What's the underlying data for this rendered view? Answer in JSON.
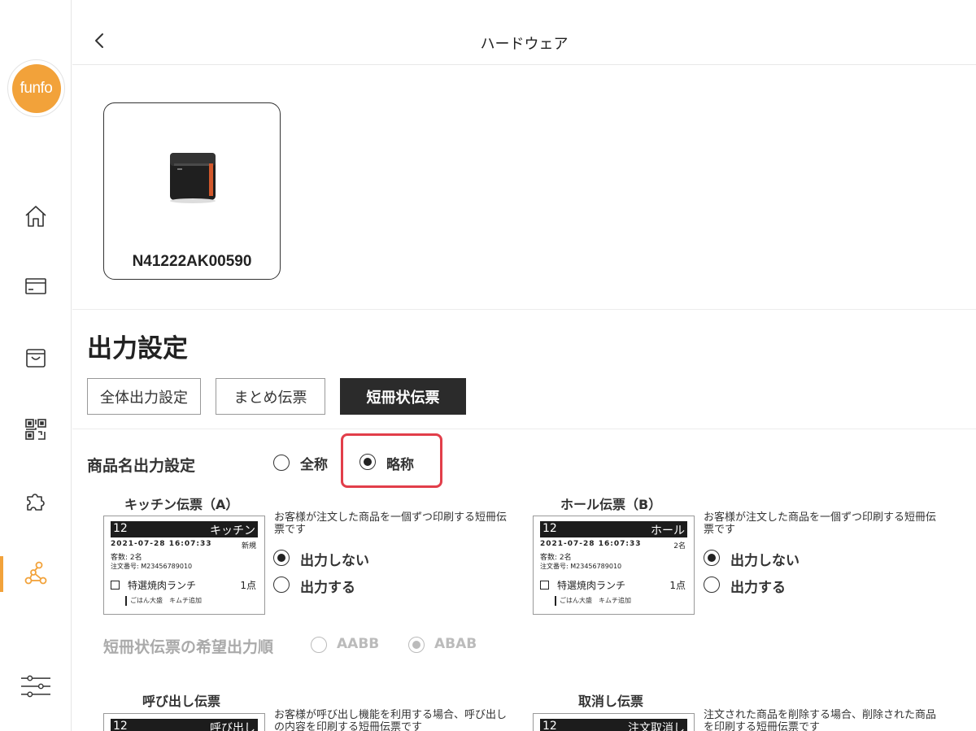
{
  "sidebar": {
    "logo_text": "funfo",
    "accent_color": "#f2a23a",
    "nav_items": [
      {
        "icon": "home-icon"
      },
      {
        "icon": "card-icon"
      },
      {
        "icon": "bag-icon"
      },
      {
        "icon": "qr-code-icon"
      },
      {
        "icon": "puzzle-icon"
      },
      {
        "icon": "network-icon",
        "active": true
      },
      {
        "icon": "settings-sliders-icon"
      }
    ]
  },
  "header": {
    "title": "ハードウェア",
    "back_icon": "chevron-left-icon"
  },
  "device": {
    "id": "N41222AK00590",
    "icon": "printer-icon"
  },
  "output_settings": {
    "title": "出力設定",
    "tabs": [
      {
        "label": "全体出力設定",
        "active": false
      },
      {
        "label": "まとめ伝票",
        "active": false
      },
      {
        "label": "短冊状伝票",
        "active": true
      }
    ],
    "product_name": {
      "label": "商品名出力設定",
      "options": [
        "全称",
        "略称"
      ],
      "selected": "略称"
    },
    "kitchen": {
      "title": "キッチン伝票（A）",
      "description": "お客様が注文した商品を一個ずつ印刷する短冊伝票です",
      "options": [
        "出力しない",
        "出力する"
      ],
      "selected": "出力しない",
      "ticket": {
        "number": "12",
        "destination": "キッチン",
        "datetime": "2021-07-28 16:07:33",
        "status": "新規",
        "guests": "客数: 2名",
        "order_no": "注文番号: M23456789010",
        "item": "特選焼肉ランチ",
        "qty": "1点",
        "options": "ごはん大盛　キムチ追加"
      }
    },
    "hall": {
      "title": "ホール伝票（B）",
      "description": "お客様が注文した商品を一個ずつ印刷する短冊伝票です",
      "options": [
        "出力しない",
        "出力する"
      ],
      "selected": "出力しない",
      "ticket": {
        "number": "12",
        "destination": "ホール",
        "datetime": "2021-07-28 16:07:33",
        "status": "2名",
        "guests": "客数: 2名",
        "order_no": "注文番号: M23456789010",
        "item": "特選焼肉ランチ",
        "qty": "1点",
        "options": "ごはん大盛　キムチ追加"
      }
    },
    "order": {
      "label": "短冊状伝票の希望出力順",
      "options": [
        "AABB",
        "ABAB"
      ],
      "selected": "ABAB",
      "disabled": true
    },
    "call": {
      "title": "呼び出し伝票",
      "description": "お客様が呼び出し機能を利用する場合、呼び出しの内容を印刷する短冊伝票です",
      "ticket": {
        "number": "12",
        "destination": "呼び出し"
      }
    },
    "cancel": {
      "title": "取消し伝票",
      "description": "注文された商品を削除する場合、削除された商品を印刷する短冊伝票です",
      "ticket": {
        "number": "12",
        "destination": "注文取消し"
      }
    }
  }
}
